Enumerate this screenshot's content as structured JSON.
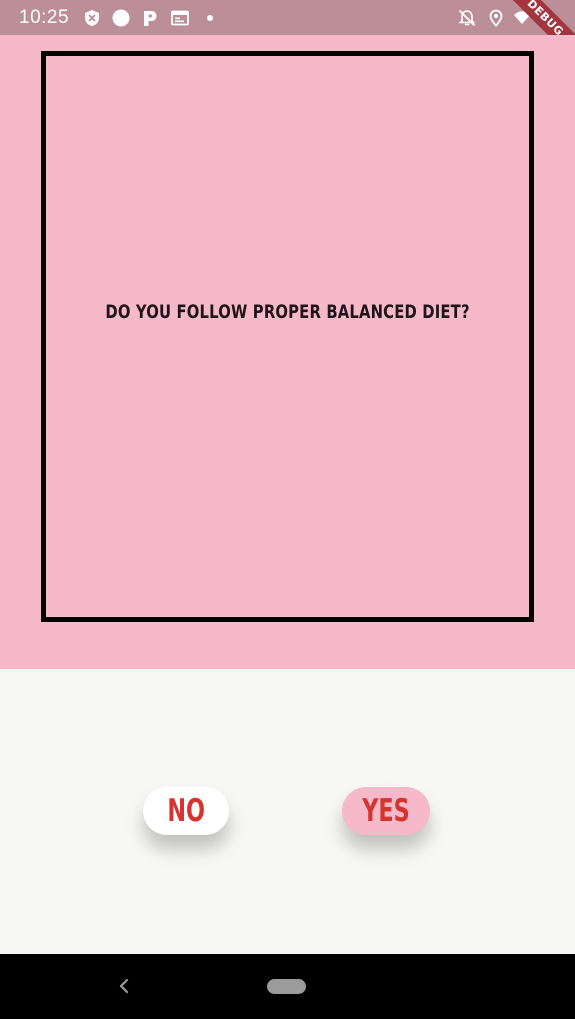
{
  "status_bar": {
    "time": "10:25",
    "icons": [
      "shield-x-icon",
      "circle-icon",
      "parking-icon",
      "calendar-icon",
      "dot-icon",
      "bell-off-icon",
      "location-icon",
      "wifi-icon",
      "battery-charging-icon"
    ],
    "debug_label": "DEBUG"
  },
  "question": {
    "text": "DO YOU FOLLOW PROPER BALANCED DIET?"
  },
  "answers": {
    "no_label": "NO",
    "yes_label": "YES"
  },
  "nav_bar": {
    "icons": [
      "back-icon",
      "home-pill-icon"
    ]
  },
  "colors": {
    "status_bar": "#bb8e98",
    "question_background": "#f6b9ca",
    "card_border": "#000000",
    "answer_background": "#f7f7f5",
    "button_text": "#d7332f",
    "no_button": "#ffffff",
    "yes_button": "#f6b9ca",
    "debug_ribbon": "#a3353f"
  }
}
